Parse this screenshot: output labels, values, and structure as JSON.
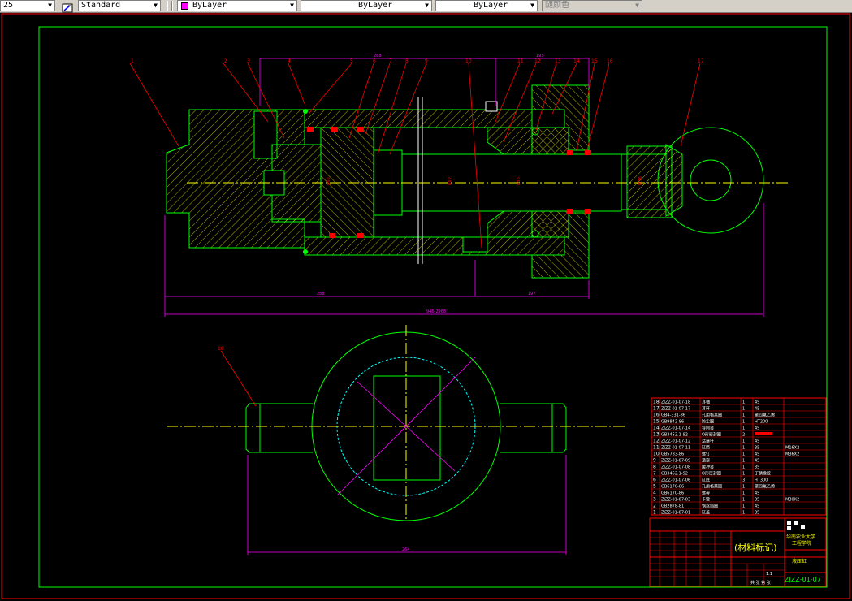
{
  "toolbar": {
    "scale_value": "25",
    "text_style": "Standard",
    "layer_color": "ByLayer",
    "linetype": "ByLayer",
    "lineweight": "ByLayer",
    "plot_style": "随颜色"
  },
  "colors": {
    "background": "#000000",
    "outline": "#00ff00",
    "annotation": "#ff0000",
    "dimension": "#ff00ff",
    "centerline": "#ffff00",
    "hatch": "#ffff00",
    "text_title": "#ffff00"
  },
  "balloons": [
    "1",
    "2",
    "3",
    "4",
    "5",
    "6",
    "7",
    "8",
    "9",
    "10",
    "11",
    "12",
    "13",
    "14",
    "15",
    "16",
    "17",
    "18"
  ],
  "dimensions": {
    "top_overall": "268",
    "top_right": "195",
    "bottom_overall": "946-2968",
    "bottom_left": "288",
    "bottom_right": "197",
    "lower_overall": "264"
  },
  "bom": {
    "rows": [
      {
        "no": "18",
        "code": "ZJZZ-01-07-18",
        "name": "耳轴",
        "qty": "1",
        "mat": "45",
        "note": ""
      },
      {
        "no": "17",
        "code": "ZJZZ-01-07-17",
        "name": "耳环",
        "qty": "1",
        "mat": "45",
        "note": ""
      },
      {
        "no": "16",
        "code": "GB4-331-86",
        "name": "孔用格莱圈",
        "qty": "1",
        "mat": "聚四氟乙烯",
        "note": ""
      },
      {
        "no": "15",
        "code": "GB9842-86",
        "name": "防尘圈",
        "qty": "1",
        "mat": "HT200",
        "note": ""
      },
      {
        "no": "14",
        "code": "ZJZZ-01-07-14",
        "name": "导向套",
        "qty": "1",
        "mat": "45",
        "note": ""
      },
      {
        "no": "13",
        "code": "GB3452.1-92",
        "name": "O形密封圈",
        "qty": "2",
        "mat": "",
        "note": ""
      },
      {
        "no": "12",
        "code": "ZJZZ-01-07-12",
        "name": "活塞杆",
        "qty": "1",
        "mat": "45",
        "note": ""
      },
      {
        "no": "11",
        "code": "ZJZZ-01-07-11",
        "name": "缸筒",
        "qty": "1",
        "mat": "35",
        "note": "M16X2"
      },
      {
        "no": "10",
        "code": "GB5783-86",
        "name": "螺钉",
        "qty": "1",
        "mat": "45",
        "note": "M36X2"
      },
      {
        "no": "9",
        "code": "ZJZZ-01-07-09",
        "name": "活塞",
        "qty": "1",
        "mat": "45",
        "note": ""
      },
      {
        "no": "8",
        "code": "ZJZZ-01-07-08",
        "name": "缓冲套",
        "qty": "1",
        "mat": "35",
        "note": ""
      },
      {
        "no": "7",
        "code": "GB3452.1-92",
        "name": "O形密封圈",
        "qty": "1",
        "mat": "丁腈橡胶",
        "note": ""
      },
      {
        "no": "6",
        "code": "ZJZZ-01-07-06",
        "name": "缸底",
        "qty": "3",
        "mat": "HT300",
        "note": ""
      },
      {
        "no": "5",
        "code": "GB6170-86",
        "name": "孔用格莱圈",
        "qty": "1",
        "mat": "聚四氟乙烯",
        "note": ""
      },
      {
        "no": "4",
        "code": "GB6170-86",
        "name": "螺母",
        "qty": "1",
        "mat": "45",
        "note": ""
      },
      {
        "no": "3",
        "code": "ZJZZ-01-07-03",
        "name": "卡键",
        "qty": "1",
        "mat": "35",
        "note": "M30X2"
      },
      {
        "no": "2",
        "code": "GB2878-81",
        "name": "钢丝挡圈",
        "qty": "1",
        "mat": "45",
        "note": ""
      },
      {
        "no": "1",
        "code": "ZJZZ-01-07-01",
        "name": "缸盖",
        "qty": "1",
        "mat": "35",
        "note": ""
      }
    ],
    "header": {
      "no": "序号",
      "code": "代号",
      "name": "名称",
      "qty": "数量",
      "mat": "材料",
      "note": "备注"
    }
  },
  "title_block": {
    "material_mark": "(材料标记)",
    "school": "华南农业大学",
    "school_sub": "工程学院",
    "drawing_name": "液压缸",
    "drawing_no": "ZJZZ-01-07",
    "scale": "1:1",
    "sheet": "共 张 第 张"
  }
}
